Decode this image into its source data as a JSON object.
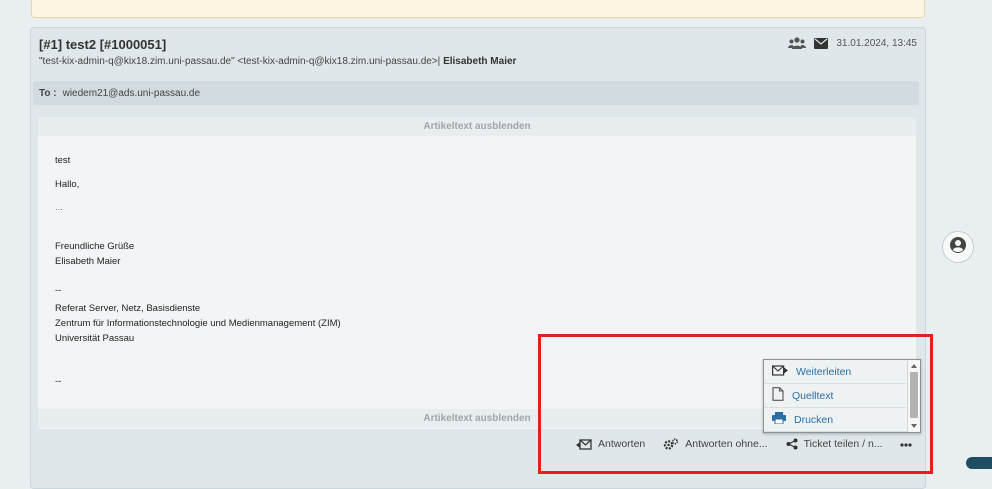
{
  "article": {
    "title": "[#1] test2 [#1000051]",
    "from_addresses": "\"test-kix-admin-q@kix18.zim.uni-passau.de\" <test-kix-admin-q@kix18.zim.uni-passau.de>",
    "separator": "|",
    "sender_name": "Elisabeth Maier",
    "datetime": "31.01.2024, 13:45",
    "icons": [
      "group-icon",
      "envelope-icon"
    ],
    "to_label": "To :",
    "to_value": "wiedem21@ads.uni-passau.de",
    "toggle_label": "Artikeltext ausblenden",
    "body_lines": [
      "test",
      "Hallo,",
      "...",
      "Freundliche Grüße",
      "Elisabeth Maier",
      "--",
      "Referat Server, Netz, Basisdienste",
      "Zentrum für Informationstechnologie und Medienmanagement (ZIM)",
      "Universität Passau",
      "--"
    ]
  },
  "actions": {
    "reply": "Antworten",
    "reply_without": "Antworten ohne...",
    "share": "Ticket teilen / n...",
    "more_icon": "ellipsis-icon"
  },
  "dropdown": {
    "items": [
      {
        "label": "Weiterleiten",
        "icon": "forward-mail-icon"
      },
      {
        "label": "Quelltext",
        "icon": "document-icon"
      },
      {
        "label": "Drucken",
        "icon": "printer-icon"
      }
    ]
  },
  "colors": {
    "highlight": "#e02121",
    "link": "#2a6ea6",
    "panel": "#dfe7ea"
  }
}
